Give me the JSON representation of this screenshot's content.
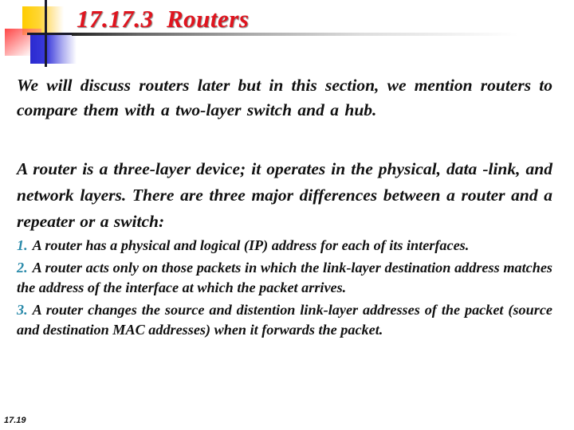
{
  "slide": {
    "title": "17.17.3  Routers",
    "paragraphs": [
      "We will discuss routers later but in this section, we mention routers to compare them with a two-layer switch and a hub.",
      "A router is a three-layer device; it operates in the physical, data -link, and network layers. There are three major differences between a router and a repeater or a switch:"
    ],
    "list_items": [
      {
        "number": "1.",
        "text": "A router has a physical and logical (IP) address for each of its interfaces."
      },
      {
        "number": "2.",
        "text": "A router acts only on those packets in which the link-layer destination address matches the address of the interface at which the packet arrives."
      },
      {
        "number": "3.",
        "text": "A router changes the source and distention link-layer addresses of the packet (source and destination MAC addresses) when it forwards the packet."
      }
    ],
    "page_number": "17.19"
  },
  "colors": {
    "title": "#e0141e",
    "list_number": "#2a8aaa",
    "body_text": "#111111",
    "logo_yellow": "#ffcc00",
    "logo_red": "#ff3c3c",
    "logo_blue": "#2a2ad0"
  }
}
